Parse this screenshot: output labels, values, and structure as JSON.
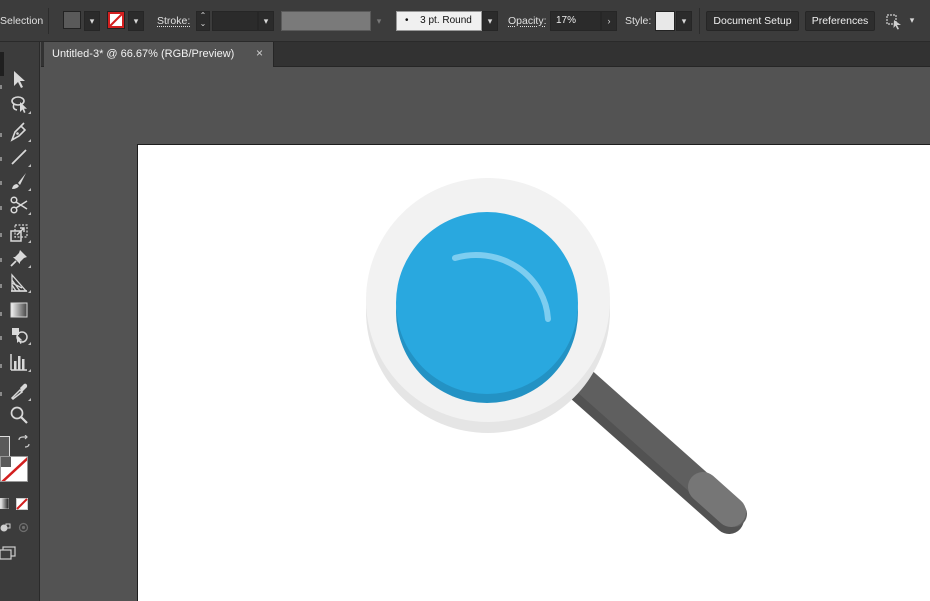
{
  "control_bar": {
    "selection_label": "Selection",
    "fill_swatch_color": "#5a5a5a",
    "stroke_swatch_icon": "stroke-none-icon",
    "stroke_label": "Stroke:",
    "stroke_weight_value": "",
    "variable_width_value": "",
    "brush_value": "3 pt. Round",
    "opacity_label": "Opacity:",
    "opacity_value": "17%",
    "style_label": "Style:",
    "document_setup_label": "Document Setup",
    "preferences_label": "Preferences",
    "arrange_icon": "arrange-documents-icon"
  },
  "tools": [
    {
      "name": "direct-selection-tool",
      "icon": "direct-selection-icon"
    },
    {
      "name": "lasso-tool",
      "icon": "lasso-icon"
    },
    {
      "name": "pen-tool",
      "icon": "pen-icon"
    },
    {
      "name": "line-segment-tool",
      "icon": "line-icon"
    },
    {
      "name": "paintbrush-tool",
      "icon": "paintbrush-icon"
    },
    {
      "name": "scissors-tool",
      "icon": "scissors-icon"
    },
    {
      "name": "scale-tool",
      "icon": "scale-icon"
    },
    {
      "name": "puppet-warp-tool",
      "icon": "pin-icon"
    },
    {
      "name": "perspective-grid-tool",
      "icon": "perspective-grid-icon"
    },
    {
      "name": "gradient-tool",
      "icon": "gradient-icon"
    },
    {
      "name": "shape-builder-tool",
      "icon": "shape-builder-icon"
    },
    {
      "name": "column-graph-tool",
      "icon": "column-graph-icon"
    },
    {
      "name": "eyedropper-tool",
      "icon": "eyedropper-icon"
    },
    {
      "name": "zoom-tool",
      "icon": "zoom-icon"
    }
  ],
  "swatches": {
    "fill_color": "#5a5a5a",
    "stroke_color": "#ffffff",
    "none_color": "#d21f1f"
  },
  "document": {
    "tab_title": "Untitled-3* @ 66.67% (RGB/Preview)",
    "close_glyph": "×"
  },
  "artwork": {
    "name": "magnifying-glass",
    "lens_color": "#29a8df",
    "lens_shadow_color": "#2392c4",
    "rim_color": "#f2f2f2",
    "rim_shadow_color": "#e5e5e5",
    "handle_color": "#5f5f5f",
    "handle_shadow_color": "#525252",
    "handle_tip_color": "#767676",
    "highlight_color": "#7dcdf0"
  }
}
